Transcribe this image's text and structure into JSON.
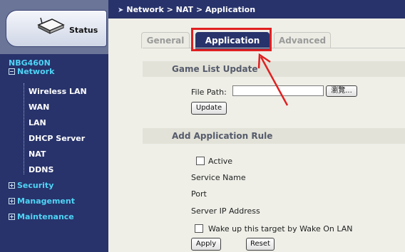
{
  "sidebar": {
    "status_label": "Status",
    "model": "NBG460N",
    "network_label": "Network",
    "network_items": [
      "Wireless LAN",
      "WAN",
      "LAN",
      "DHCP Server",
      "NAT",
      "DDNS"
    ],
    "groups": [
      "Security",
      "Management",
      "Maintenance"
    ]
  },
  "breadcrumb": "Network > NAT > Application",
  "tabs": [
    {
      "label": "General",
      "active": false
    },
    {
      "label": "Application",
      "active": true
    },
    {
      "label": "Advanced",
      "active": false
    }
  ],
  "game_list": {
    "title": "Game List Update",
    "file_path_label": "File Path:",
    "file_path_value": "",
    "browse_label": "瀏覽...",
    "update_label": "Update"
  },
  "add_rule": {
    "title": "Add Application Rule",
    "active_label": "Active",
    "service_name_label": "Service Name",
    "port_label": "Port",
    "server_ip_label": "Server IP Address",
    "wol_label": "Wake up this target by Wake On LAN",
    "apply_label": "Apply",
    "reset_label": "Reset"
  },
  "colors": {
    "sidebar_bg": "#28336b",
    "accent_cyan": "#4fd4f6",
    "highlight_red": "#e02020",
    "active_tab": "#28336b"
  }
}
